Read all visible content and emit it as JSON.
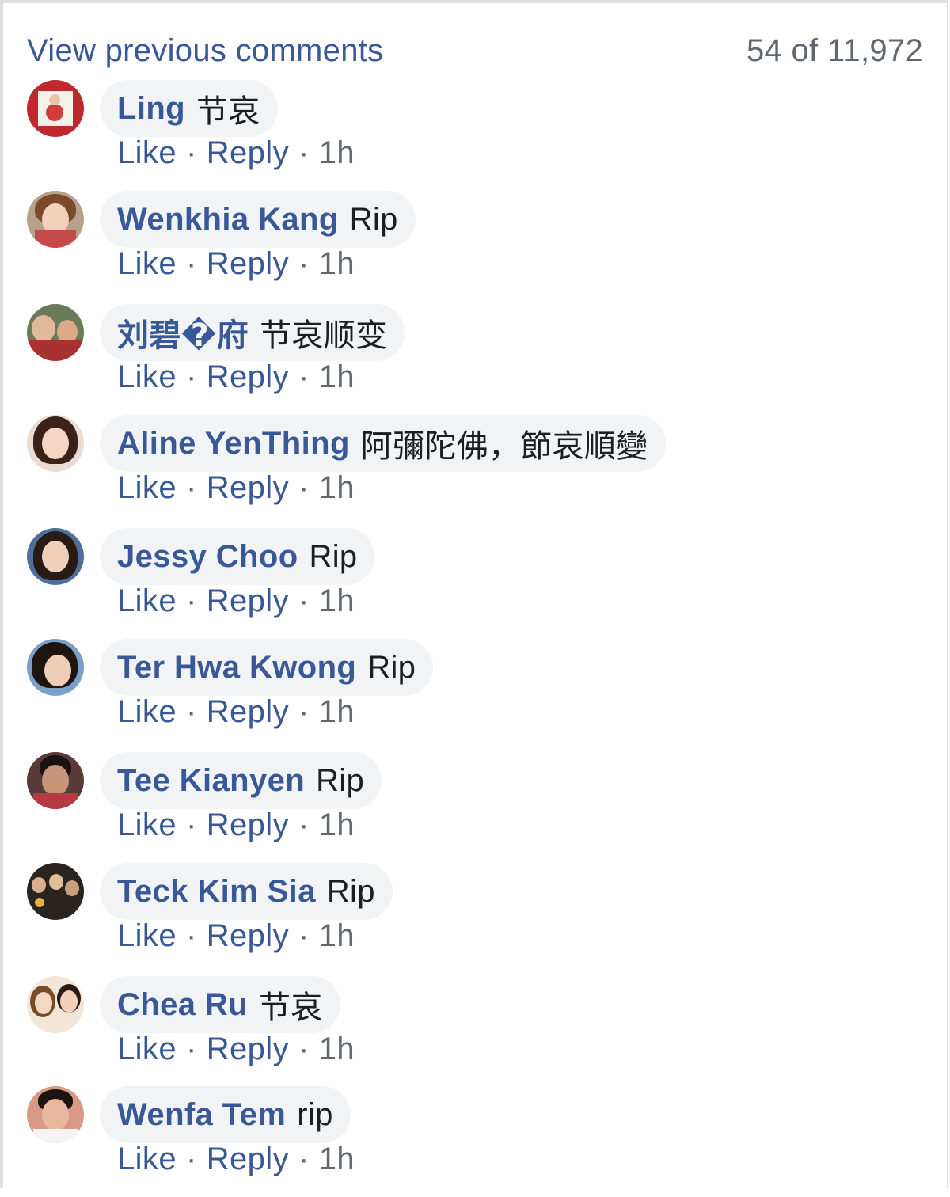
{
  "header": {
    "view_previous": "View previous comments",
    "count": "54 of 11,972"
  },
  "actions": {
    "like": "Like",
    "reply": "Reply",
    "separator": "·"
  },
  "comments": [
    {
      "author": "Ling",
      "text": "节哀",
      "time": "1h"
    },
    {
      "author": "Wenkhia Kang",
      "text": "Rip",
      "time": "1h"
    },
    {
      "author": "刘碧�府",
      "text": "节哀顺变",
      "time": "1h"
    },
    {
      "author": "Aline YenThing",
      "text": "阿彌陀佛，節哀順變",
      "time": "1h"
    },
    {
      "author": "Jessy Choo",
      "text": "Rip",
      "time": "1h"
    },
    {
      "author": "Ter Hwa Kwong",
      "text": "Rip",
      "time": "1h"
    },
    {
      "author": "Tee Kianyen",
      "text": "Rip",
      "time": "1h"
    },
    {
      "author": "Teck Kim Sia",
      "text": "Rip",
      "time": "1h"
    },
    {
      "author": "Chea Ru",
      "text": "节哀",
      "time": "1h"
    },
    {
      "author": "Wenfa Tem",
      "text": "rip",
      "time": "1h"
    }
  ],
  "colors": {
    "link": "#385898",
    "bubble": "#f2f3f5",
    "meta": "#606770",
    "text": "#1c1e21"
  }
}
